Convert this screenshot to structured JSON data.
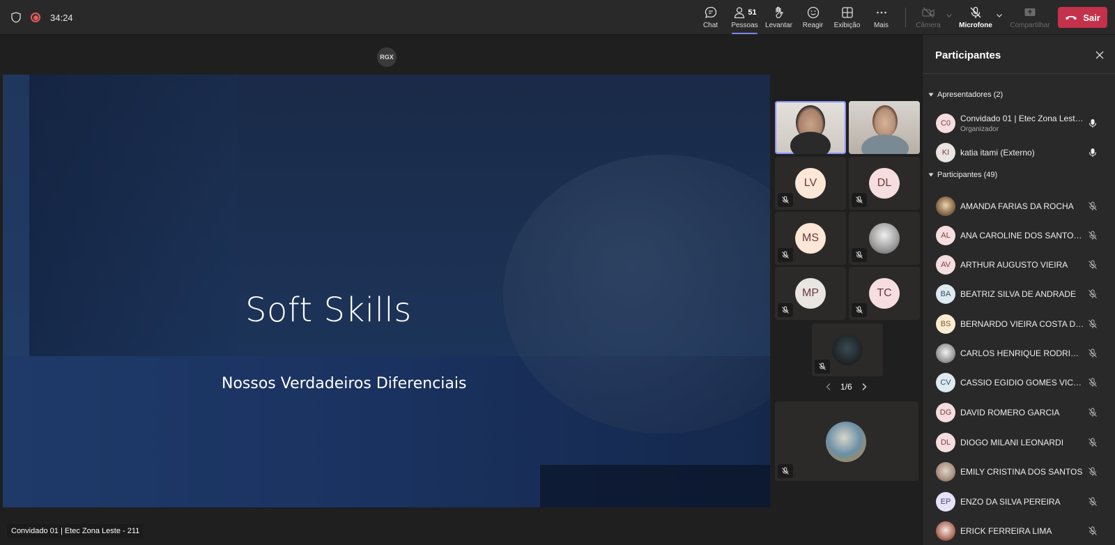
{
  "top_bar": {
    "timer": "34:24",
    "actions": [
      {
        "id": "chat",
        "label": "Chat"
      },
      {
        "id": "people",
        "label": "Pessoas",
        "count": "51"
      },
      {
        "id": "raise",
        "label": "Levantar"
      },
      {
        "id": "react",
        "label": "Reagir"
      },
      {
        "id": "view",
        "label": "Exibição"
      },
      {
        "id": "more",
        "label": "Mais"
      }
    ],
    "camera_label": "Câmera",
    "microphone_label": "Microfone",
    "share_label": "Compartilhar",
    "leave_label": "Sair"
  },
  "stage": {
    "presenter_badge": "RGX",
    "slide_title": "Soft Skills",
    "slide_subtitle": "Nossos Verdadeiros Diferenciais",
    "presenter_label": "Convidado 01 | Etec Zona Leste - 211"
  },
  "video_grid": {
    "tiles": [
      {
        "initials": "LV"
      },
      {
        "initials": "DL"
      },
      {
        "initials": "MS"
      },
      {
        "initials": ""
      },
      {
        "initials": "MP"
      },
      {
        "initials": "TC"
      }
    ],
    "pager": "1/6"
  },
  "participants_panel": {
    "title": "Participantes",
    "presenters_header": "Apresentadores (2)",
    "presenters": [
      {
        "initials": "C0",
        "name": "Convidado 01 | Etec Zona Leste - 211",
        "role": "Organizador"
      },
      {
        "initials": "KI",
        "name": "katia itami (Externo)",
        "role": ""
      }
    ],
    "participants_header": "Participantes (49)",
    "participants": [
      {
        "initials": "",
        "name": "AMANDA FARIAS DA ROCHA"
      },
      {
        "initials": "AL",
        "name": "ANA CAROLINE DOS SANTOS LIMA"
      },
      {
        "initials": "AV",
        "name": "ARTHUR AUGUSTO VIEIRA"
      },
      {
        "initials": "BA",
        "name": "BEATRIZ SILVA DE ANDRADE"
      },
      {
        "initials": "BS",
        "name": "BERNARDO VIEIRA COSTA DOS SANTOS"
      },
      {
        "initials": "",
        "name": "CARLOS HENRIQUE RODRIGUES"
      },
      {
        "initials": "CV",
        "name": "CASSIO EGIDIO GOMES VICENTE"
      },
      {
        "initials": "DG",
        "name": "DAVID ROMERO GARCIA"
      },
      {
        "initials": "DL",
        "name": "DIOGO MILANI LEONARDI"
      },
      {
        "initials": "",
        "name": "EMILY CRISTINA DOS SANTOS"
      },
      {
        "initials": "EP",
        "name": "ENZO DA SILVA PEREIRA"
      },
      {
        "initials": "",
        "name": "ERICK FERREIRA LIMA"
      }
    ]
  },
  "colors": {
    "leave": "#c4314b",
    "accent": "#7f85f5",
    "recording": "#e25c5c"
  }
}
